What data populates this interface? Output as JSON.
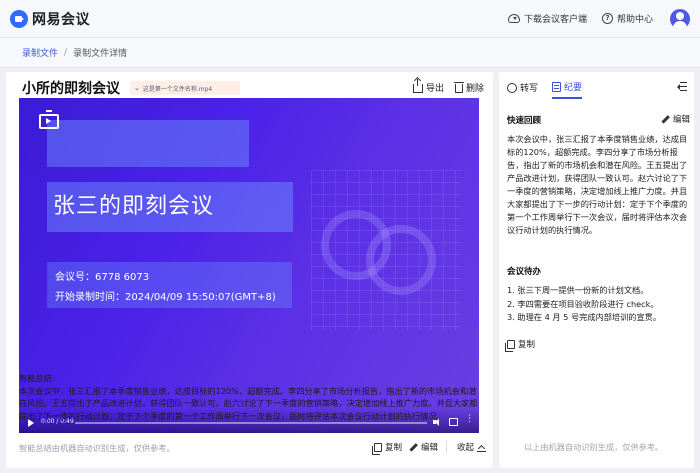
{
  "app": {
    "title": "网易会议"
  },
  "topbar": {
    "download_label": "下载会议客户端",
    "help_label": "帮助中心"
  },
  "breadcrumb": {
    "parent": "录制文件",
    "separator": "/",
    "current": "录制文件详情"
  },
  "header": {
    "title": "小所的即刻会议",
    "file_name": "这是第一个文件名称.mp4",
    "export_label": "导出",
    "delete_label": "删除"
  },
  "video": {
    "title": "张三的即刻会议",
    "meeting_id_line": "会议号：6778 6073",
    "start_time_line": "开始录制时间：2024/04/09 15:50:07(GMT+8)",
    "time": "0:00 / 0:49",
    "progress": 0
  },
  "summary": {
    "label": "智能总结:",
    "text": "本次会议中，张三汇报了本季度销售业绩，达成目标的120%，超额完成。李四分享了市场分析报告，指出了新的市场机会和潜在风险。王五提出了产品改进计划，获得团队一致认可。赵六讨论了下一季度的营销策略，决定增加线上推广力度。并且大家都提出了下一步的行动计划：定于下个季度的第一个工作周举行下一次会议，届时将评估本次会议行动计划的执行情况。",
    "disclaimer": "智能总结由机器自动识别生成，仅供参考。",
    "copy_label": "复制",
    "edit_label": "编辑",
    "collapse_label": "收起"
  },
  "right_panel": {
    "tabs": [
      {
        "label": "转写"
      },
      {
        "label": "纪要"
      }
    ],
    "quick_review": {
      "title": "快速回顾",
      "edit_label": "编辑",
      "text": "本次会议中，张三汇报了本季度销售业绩，达成目标的120%，超额完成。李四分享了市场分析报告，指出了新的市场机会和潜在风险。王五提出了产品改进计划，获得团队一致认可。赵六讨论了下一季度的营销策略，决定增加线上推广力度。并且大家都提出了下一步的行动计划：定于下个季度的第一个工作周举行下一次会议，届时将评估本次会议行动计划的执行情况。"
    },
    "todo": {
      "title": "会议待办",
      "items": [
        "1. 张三下周一提供一份新的计划文档。",
        "2. 李四需要在项目验收阶段进行 check。",
        "3. 助理在 4 月 5 号完成内部培训的宣贯。"
      ],
      "copy_label": "复制"
    },
    "disclaimer": "以上由机器自动识别生成，仅供参考。"
  }
}
